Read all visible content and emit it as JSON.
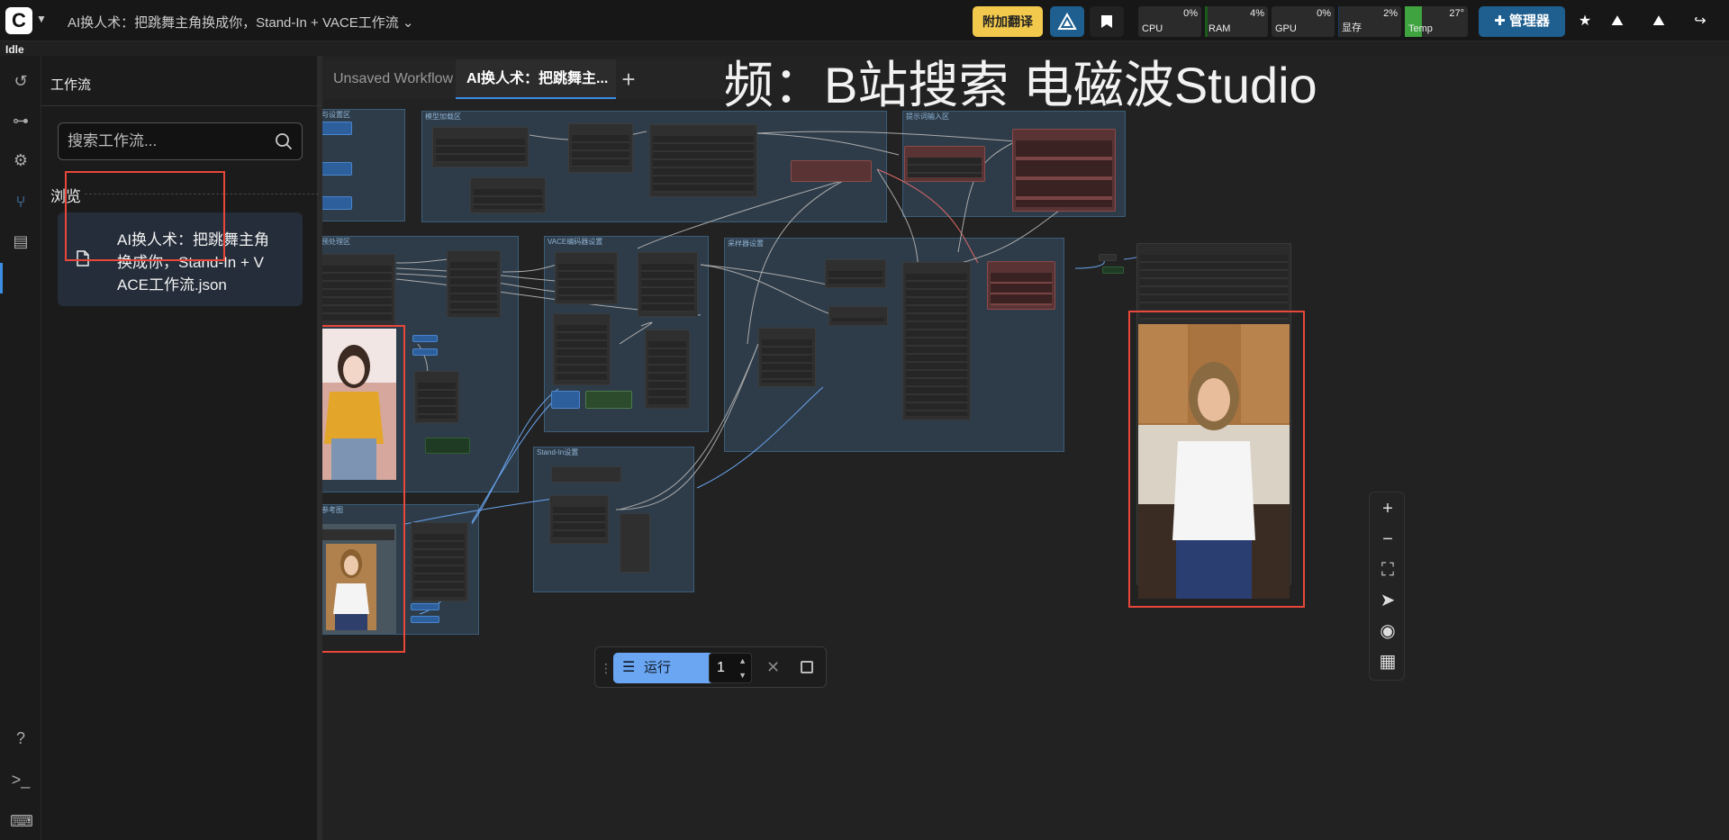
{
  "topbar": {
    "workflow_title": "AI换人术：把跳舞主角换成你，Stand-In + VACE工作流",
    "title_caret": "⌄",
    "translate_button": "附加翻译",
    "manager_button": "管理器",
    "meters": [
      {
        "label": "CPU",
        "value": "0%",
        "level": 0
      },
      {
        "label": "RAM",
        "value": "4%",
        "level": 4
      },
      {
        "label": "GPU",
        "value": "0%",
        "level": 0
      },
      {
        "label": "显存",
        "value": "2%",
        "level": 2
      },
      {
        "label": "Temp",
        "value": "27°",
        "level": 27
      }
    ]
  },
  "status": {
    "queue": "Idle"
  },
  "sidebar": {
    "title": "工作流",
    "search_placeholder": "搜索工作流...",
    "browse_label": "浏览",
    "items": [
      {
        "label": "AI换人术：把跳舞主角换成你，Stand-In + VACE工作流.json"
      }
    ]
  },
  "canvas": {
    "tabs": [
      {
        "label": "Unsaved Workflow",
        "active": false
      },
      {
        "label": "AI换人术：把跳舞主...",
        "active": true
      }
    ],
    "add_tab": "+",
    "watermark_title": "频：B站搜索 电磁波Studio",
    "groups": [
      {
        "title": "加载与设置区"
      },
      {
        "title": "模型加载区"
      },
      {
        "title": "提示词输入区"
      },
      {
        "title": "视频预处理区"
      },
      {
        "title": "VACE编码器设置"
      },
      {
        "title": "采样器设置"
      },
      {
        "title": "Stand-In设置"
      },
      {
        "title": "人物参考图"
      }
    ]
  },
  "runbar": {
    "run_label": "运行",
    "batch_count": "1"
  },
  "icons": {
    "rail": [
      "history-icon",
      "queue-icon",
      "node-library-icon",
      "workflows-icon",
      "templates-icon",
      "help-icon",
      "terminal-icon",
      "keyboard-icon"
    ],
    "tools": [
      "zoom-in-icon",
      "zoom-out-icon",
      "fit-view-icon",
      "select-mode-icon",
      "toggle-links-icon",
      "minimap-icon"
    ]
  },
  "colors": {
    "accent": "#3c8de5",
    "run_button": "#6aa6f2",
    "highlight_box": "#e8473a",
    "translate_button": "#f2c94c",
    "manager_button": "#1e5f8f"
  }
}
